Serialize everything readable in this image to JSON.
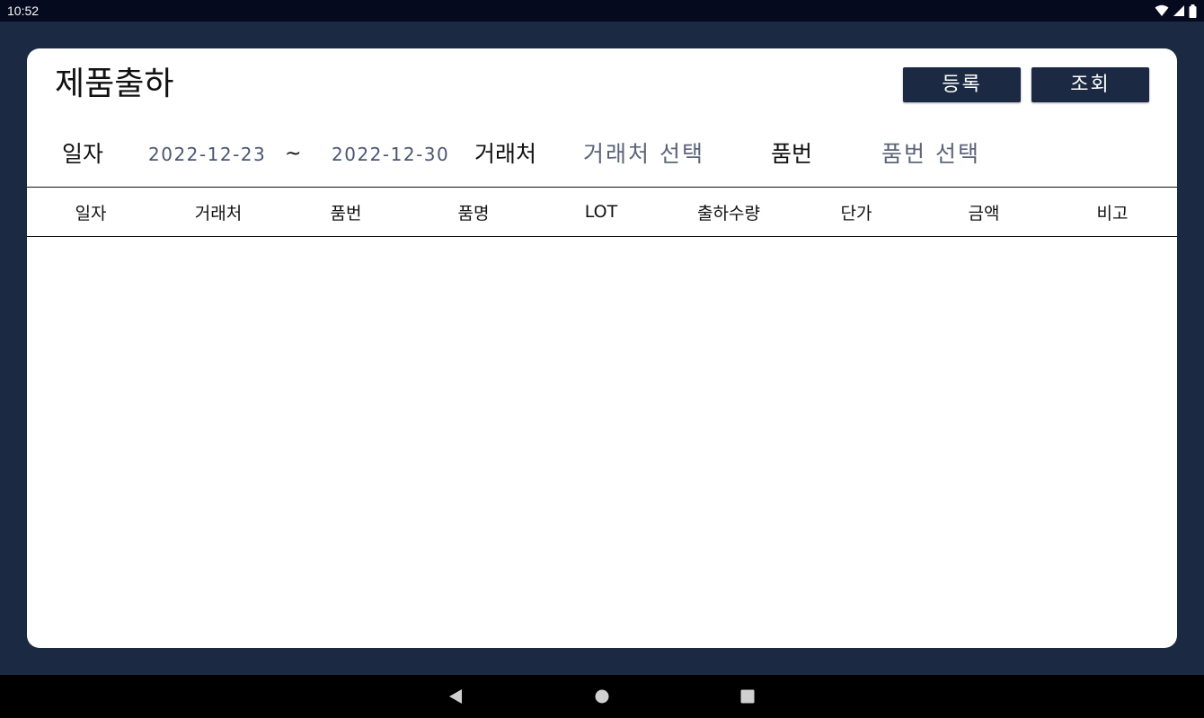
{
  "status_bar": {
    "time": "10:52",
    "icons": [
      "wifi-icon",
      "signal-icon",
      "battery-icon"
    ]
  },
  "page": {
    "title": "제품출하"
  },
  "buttons": {
    "register": "등록",
    "search": "조회"
  },
  "filters": {
    "date_label": "일자",
    "date_from": "2022-12-23",
    "date_separator": "~",
    "date_to": "2022-12-30",
    "client_label": "거래처",
    "client_placeholder": "거래처 선택",
    "item_label": "품번",
    "item_placeholder": "품번 선택"
  },
  "table": {
    "columns": [
      "일자",
      "거래처",
      "품번",
      "품명",
      "LOT",
      "출하수량",
      "단가",
      "금액",
      "비고"
    ],
    "rows": []
  },
  "nav_bar": {
    "icons": [
      "back-icon",
      "home-icon",
      "recents-icon"
    ]
  },
  "colors": {
    "background": "#1b2a42",
    "status_bar": "#050a1e",
    "button": "#1b2a42",
    "card": "#ffffff"
  }
}
